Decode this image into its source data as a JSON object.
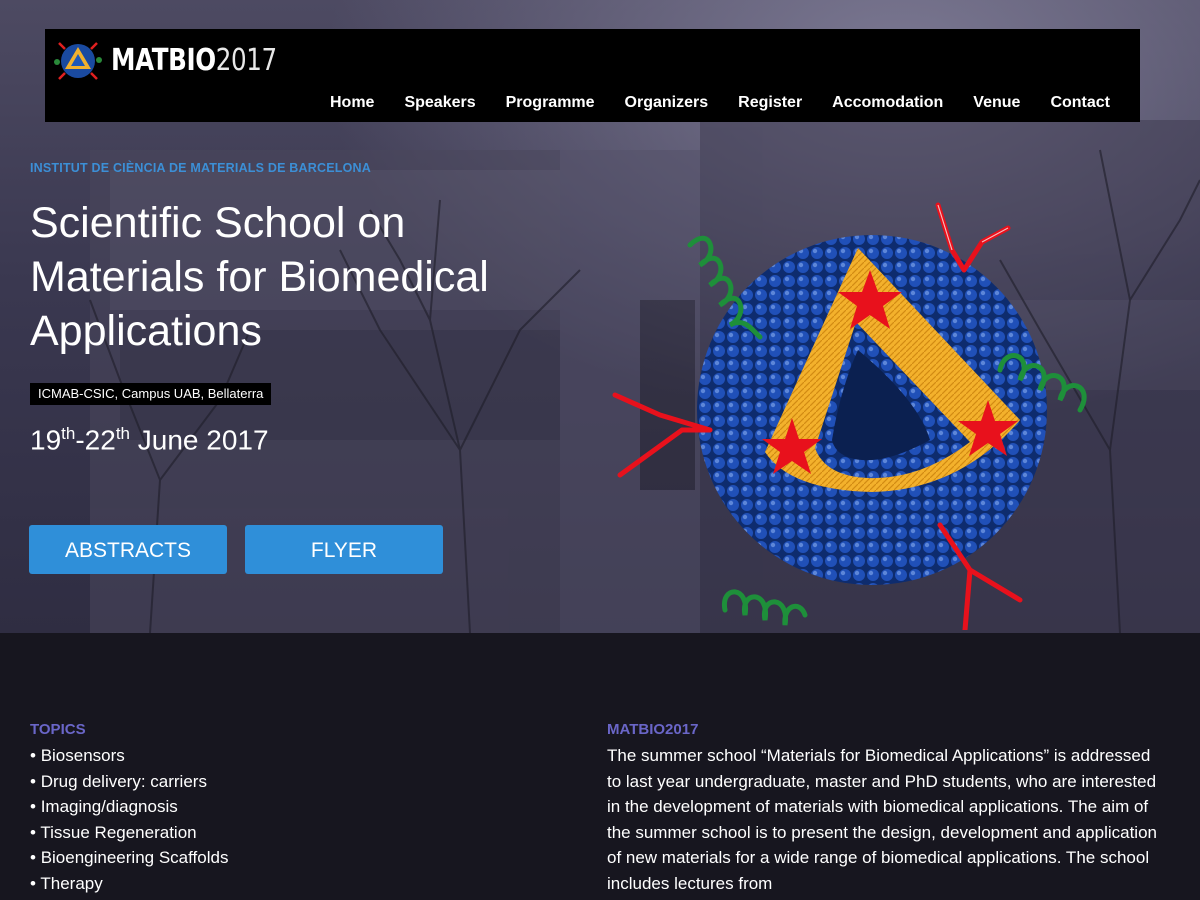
{
  "brand": {
    "name": "MATBIO",
    "year": "2017"
  },
  "nav": [
    "Home",
    "Speakers",
    "Programme",
    "Organizers",
    "Register",
    "Accomodation",
    "Venue",
    "Contact"
  ],
  "hero": {
    "institute": "INSTITUT DE CIÈNCIA DE MATERIALS DE BARCELONA",
    "title": "Scientific School on Materials for Biomedical Applications",
    "venue": "ICMAB-CSIC, Campus UAB, Bellaterra",
    "dates": {
      "d1": "19",
      "sup1": "th",
      "d2": "-22",
      "sup2": "th",
      "rest": " June 2017"
    },
    "buttons": {
      "abstracts": "ABSTRACTS",
      "flyer": "FLYER"
    }
  },
  "topics": {
    "heading": "TOPICS",
    "items": [
      "Biosensors",
      "Drug delivery: carriers",
      "Imaging/diagnosis",
      "Tissue Regeneration",
      "Bioengineering Scaffolds",
      "Therapy"
    ]
  },
  "about": {
    "heading": "MATBIO2017",
    "text": "The summer school “Materials for Biomedical Applications” is addressed to last year undergraduate, master and PhD students, who are interested in the development of materials with biomedical applications. The aim of the summer school is to present the design, development and application of new materials for a wide range of biomedical applications. The school includes lectures from"
  },
  "colors": {
    "accent": "#2f8fd9",
    "institute": "#3c8fd6",
    "heading": "#6a66c8"
  }
}
